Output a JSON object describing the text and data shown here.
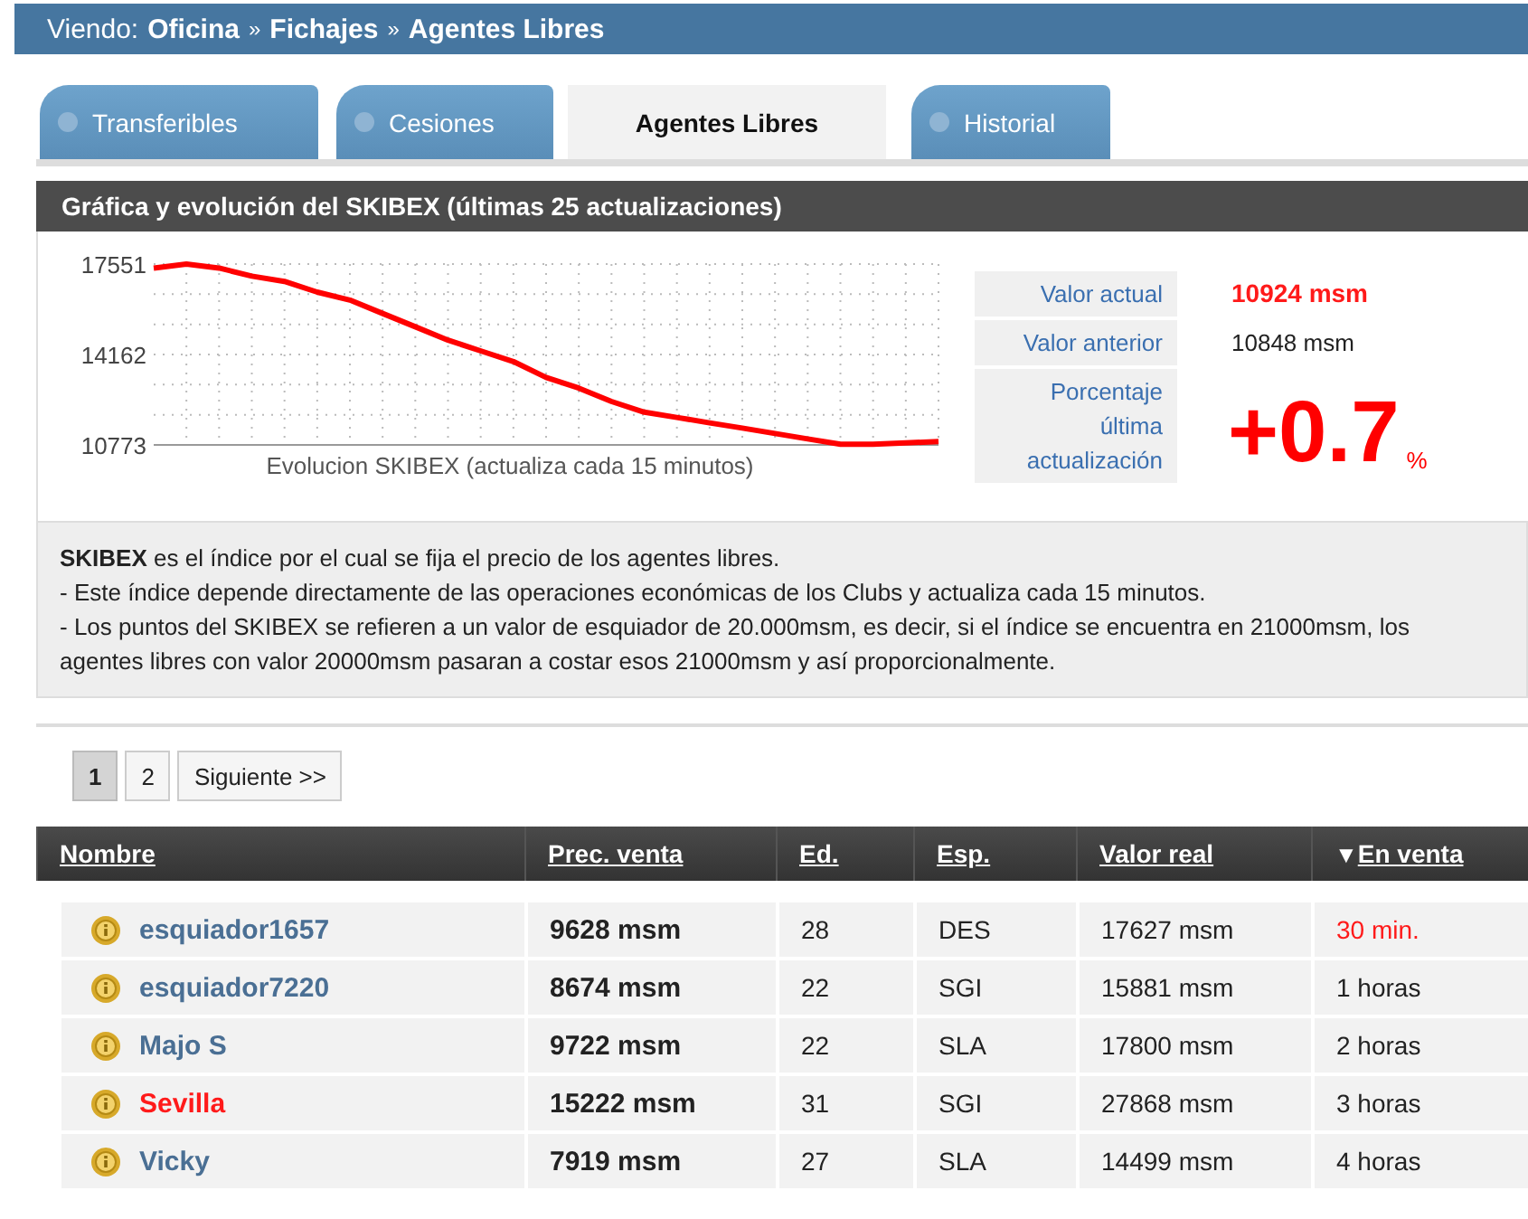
{
  "breadcrumb": {
    "prefix": "Viendo:",
    "items": [
      "Oficina",
      "Fichajes",
      "Agentes Libres"
    ],
    "separator": "»"
  },
  "tabs": [
    {
      "label": "Transferibles",
      "selected": false
    },
    {
      "label": "Cesiones",
      "selected": false
    },
    {
      "label": "Agentes Libres",
      "selected": true
    },
    {
      "label": "Historial",
      "selected": false
    }
  ],
  "chart_panel": {
    "title": "Gráfica y evolución del SKIBEX (últimas 25 actualizaciones)",
    "chart_data": {
      "type": "line",
      "grid": true,
      "xlabel": "Evolucion SKIBEX (actualiza cada 15 minutos)",
      "ylim": [
        10773,
        17551
      ],
      "yticks": [
        10773,
        14162,
        17551
      ],
      "series": [
        {
          "color": "#ff0000",
          "values": [
            17400,
            17550,
            17400,
            17100,
            16900,
            16500,
            16200,
            15700,
            15200,
            14700,
            14300,
            13900,
            13300,
            12900,
            12400,
            12000,
            11800,
            11600,
            11400,
            11200,
            11000,
            10800,
            10800,
            10850,
            10900
          ]
        }
      ]
    },
    "stats": [
      {
        "label": "Valor actual",
        "value": "10924 msm",
        "kind": "highlight"
      },
      {
        "label": "Valor anterior",
        "value": "10848 msm",
        "kind": "plain"
      },
      {
        "label": "Porcentaje última actualización",
        "value": "+0.7",
        "unit": "%",
        "kind": "big"
      }
    ]
  },
  "info": {
    "lines": [
      "**SKIBEX** es el índice por el cual se fija el precio de los agentes libres.",
      "- Este índice depende directamente de las operaciones económicas de los Clubs y actualiza cada 15 minutos.",
      "- Los puntos del SKIBEX se refieren a un valor de esquiador de 20.000msm, es decir, si el índice se encuentra en 21000msm, los agentes libres con valor 20000msm pasaran a costar esos 21000msm y así proporcionalmente."
    ]
  },
  "pagination": {
    "pages": [
      {
        "label": "1",
        "selected": true
      },
      {
        "label": "2",
        "selected": false
      }
    ],
    "next": "Siguiente >>"
  },
  "table": {
    "columns": [
      {
        "label": "Nombre"
      },
      {
        "label": "Prec. venta"
      },
      {
        "label": "Ed."
      },
      {
        "label": "Esp."
      },
      {
        "label": "Valor real"
      },
      {
        "label": "En venta",
        "sort_icon": "▼"
      }
    ],
    "rows": [
      {
        "name": "esquiador1657",
        "highlighted": false,
        "price": "9628 msm",
        "age": "28",
        "esp": "DES",
        "value": "17627 msm",
        "time": "30 min.",
        "urgent": true
      },
      {
        "name": "esquiador7220",
        "highlighted": false,
        "price": "8674 msm",
        "age": "22",
        "esp": "SGI",
        "value": "15881 msm",
        "time": "1 horas",
        "urgent": false
      },
      {
        "name": "Majo S",
        "highlighted": false,
        "price": "9722 msm",
        "age": "22",
        "esp": "SLA",
        "value": "17800 msm",
        "time": "2 horas",
        "urgent": false
      },
      {
        "name": "Sevilla",
        "highlighted": true,
        "price": "15222 msm",
        "age": "31",
        "esp": "SGI",
        "value": "27868 msm",
        "time": "3 horas",
        "urgent": false
      },
      {
        "name": "Vicky",
        "highlighted": false,
        "price": "7919 msm",
        "age": "27",
        "esp": "SLA",
        "value": "14499 msm",
        "time": "4 horas",
        "urgent": false
      }
    ]
  }
}
